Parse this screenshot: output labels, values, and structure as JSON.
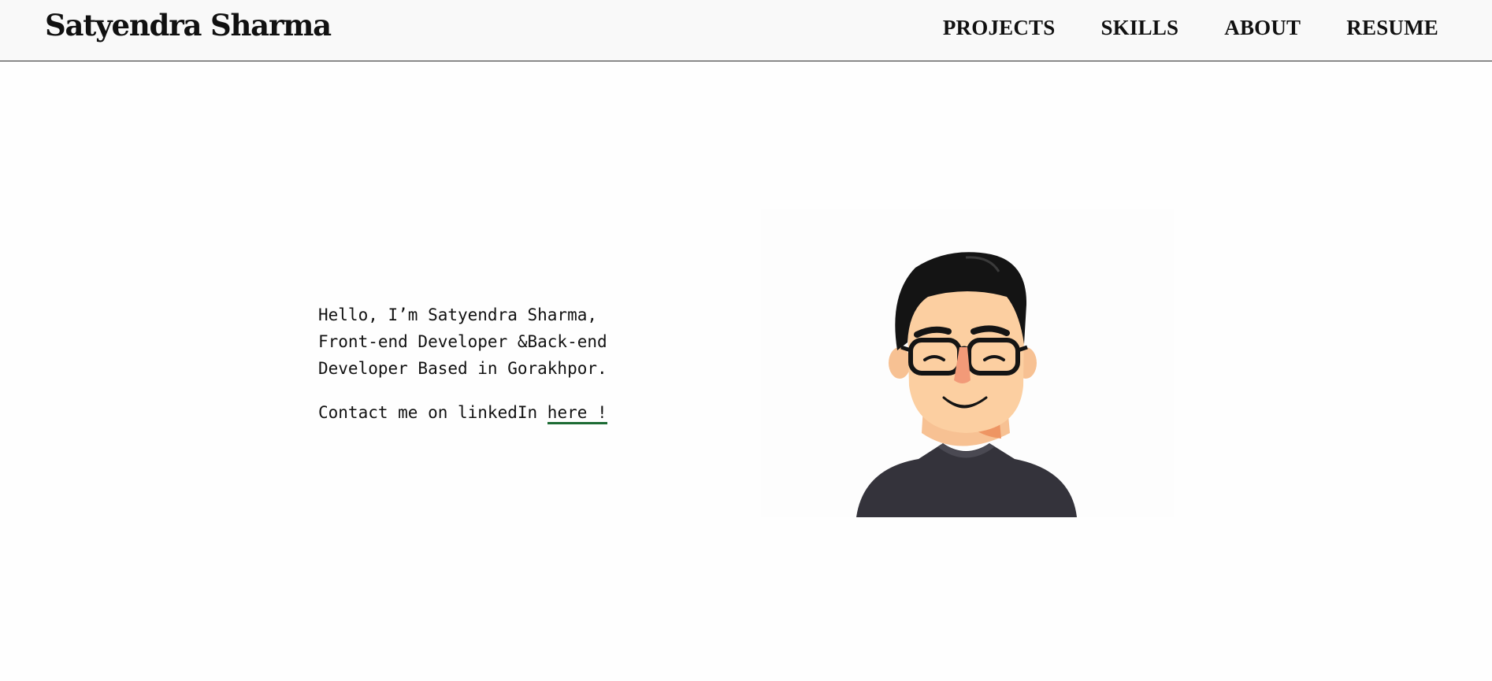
{
  "header": {
    "brand": "Satyendra Sharma",
    "nav": [
      {
        "label": "PROJECTS"
      },
      {
        "label": "SKILLS"
      },
      {
        "label": "ABOUT"
      },
      {
        "label": "RESUME"
      }
    ]
  },
  "hero": {
    "intro_lines": [
      "Hello, I’m Satyendra Sharma,",
      "Front-end Developer &Back-end",
      "Developer Based in Gorakhpor."
    ],
    "contact_prefix": "Contact me on linkedIn ",
    "contact_link": "here !",
    "avatar_icon": "avatar-illustration"
  },
  "colors": {
    "link_underline": "#1c6b34",
    "header_bg": "#f9f9f9"
  }
}
